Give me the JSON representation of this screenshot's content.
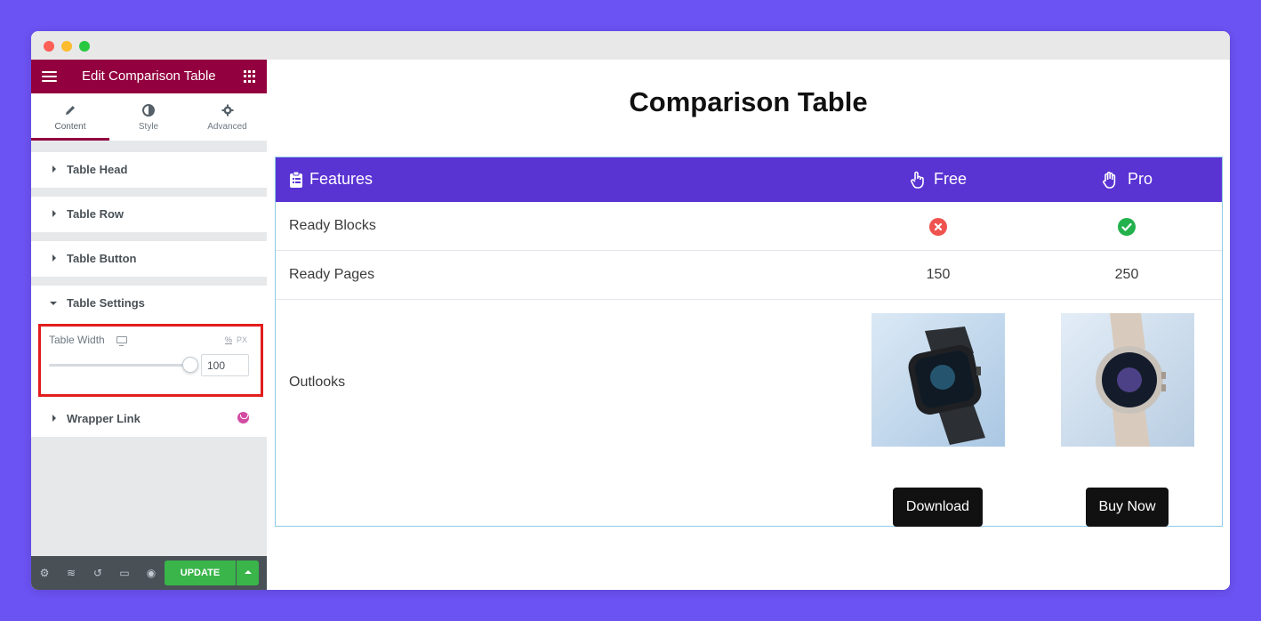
{
  "panel": {
    "title": "Edit Comparison Table",
    "tabs": [
      {
        "label": "Content",
        "icon": "pencil-icon"
      },
      {
        "label": "Style",
        "icon": "half-circle-icon"
      },
      {
        "label": "Advanced",
        "icon": "gear-icon"
      }
    ],
    "sections": [
      {
        "label": "Table Head"
      },
      {
        "label": "Table Row"
      },
      {
        "label": "Table Button"
      },
      {
        "label": "Table Settings"
      },
      {
        "label": "Wrapper Link"
      }
    ],
    "settings": {
      "width_label": "Table Width",
      "unit_link": "%",
      "unit": "PX",
      "width_value": "100",
      "slider_fraction": 1.0
    },
    "footer": {
      "update_label": "UPDATE"
    }
  },
  "preview": {
    "title": "Comparison Table",
    "header": {
      "features": "Features",
      "free": "Free",
      "pro": "Pro"
    },
    "rows": [
      {
        "label": "Ready Blocks",
        "free": "no",
        "pro": "yes"
      },
      {
        "label": "Ready Pages",
        "free": "150",
        "pro": "250"
      },
      {
        "label": "Outlooks"
      }
    ],
    "buttons": {
      "free": "Download",
      "pro": "Buy Now"
    }
  },
  "colors": {
    "background": "#6b52f2",
    "panel_header": "#93003f",
    "table_header": "#5a33d3",
    "update": "#39b54a",
    "highlight": "#e11d1d",
    "no_icon": "#ef5350",
    "yes_icon": "#23b14d"
  }
}
